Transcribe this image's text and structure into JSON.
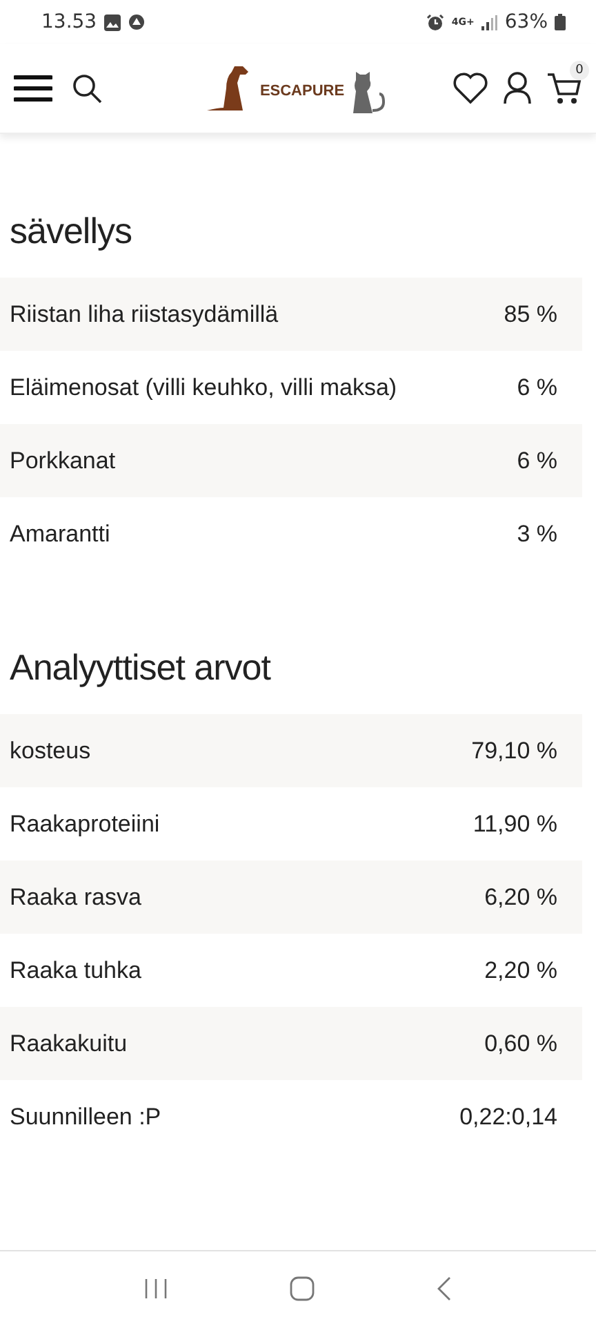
{
  "status_bar": {
    "time": "13.53",
    "network": "4G+",
    "battery": "63%"
  },
  "header": {
    "logo": "ESCAPURE",
    "cart_count": "0"
  },
  "sections": [
    {
      "title": "sävellys",
      "rows": [
        {
          "label": "Riistan liha riistasydämillä",
          "value": "85 %"
        },
        {
          "label": "Eläimenosat (villi keuhko, villi maksa)",
          "value": "6 %"
        },
        {
          "label": "Porkkanat",
          "value": "6 %"
        },
        {
          "label": "Amarantti",
          "value": "3 %"
        }
      ]
    },
    {
      "title": "Analyyttiset arvot",
      "rows": [
        {
          "label": "kosteus",
          "value": "79,10 %"
        },
        {
          "label": "Raakaproteiini",
          "value": "11,90 %"
        },
        {
          "label": "Raaka rasva",
          "value": "6,20 %"
        },
        {
          "label": "Raaka tuhka",
          "value": "2,20 %"
        },
        {
          "label": "Raakakuitu",
          "value": "0,60 %"
        },
        {
          "label": "Suunnilleen :P",
          "value": "0,22:0,14"
        }
      ]
    }
  ]
}
